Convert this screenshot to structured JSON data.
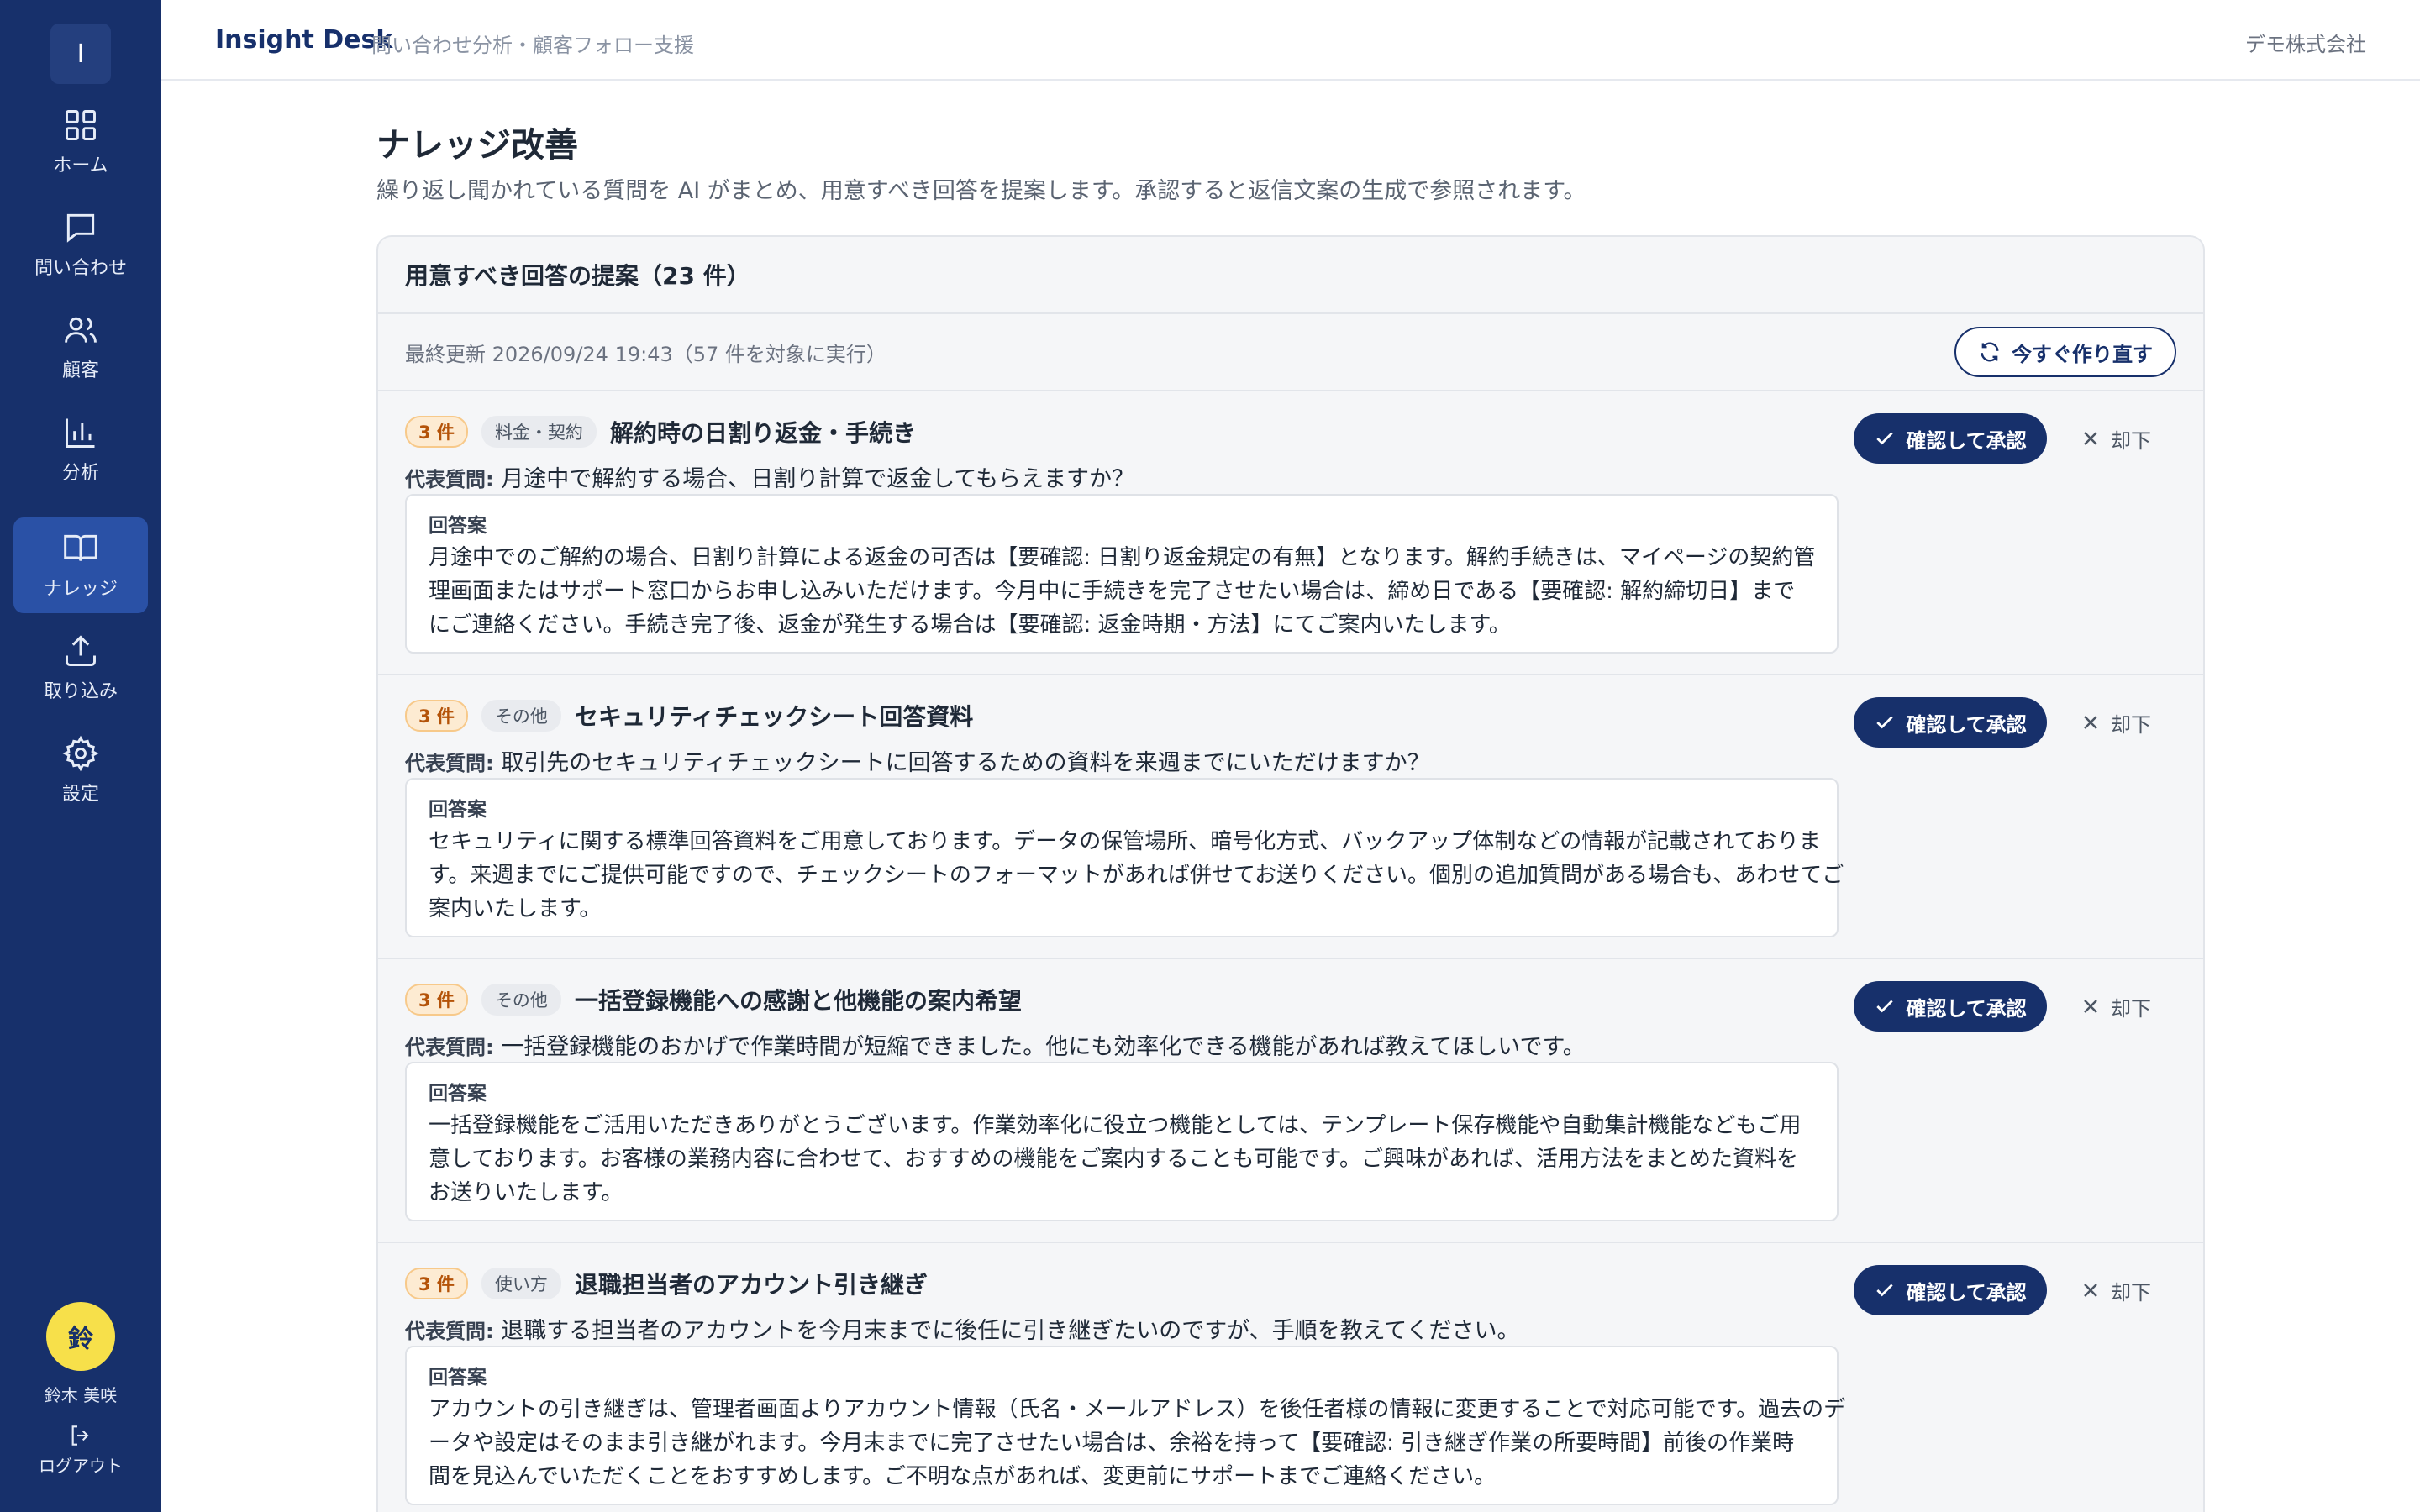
{
  "sidebar": {
    "logo": "I",
    "items": [
      {
        "label": "ホーム",
        "icon": "grid-icon"
      },
      {
        "label": "問い合わせ",
        "icon": "message-icon"
      },
      {
        "label": "顧客",
        "icon": "users-icon"
      },
      {
        "label": "分析",
        "icon": "bar-chart-icon"
      },
      {
        "label": "ナレッジ",
        "icon": "book-icon",
        "active": true
      },
      {
        "label": "取り込み",
        "icon": "upload-icon"
      },
      {
        "label": "設定",
        "icon": "gear-icon"
      }
    ],
    "user": {
      "avatar": "鈴",
      "name": "鈴木 美咲"
    },
    "logout": "ログアウト"
  },
  "header": {
    "app_name": "Insight Desk",
    "tagline": "問い合わせ分析・顧客フォロー支援",
    "company": "デモ株式会社"
  },
  "page": {
    "title": "ナレッジ改善",
    "description": "繰り返し聞かれている質問を AI がまとめ、用意すべき回答を提案します。承認すると返信文案の生成で参照されます。"
  },
  "panel": {
    "title": "用意すべき回答の提案（23 件）",
    "last_updated": "最終更新 2026/09/24 19:43（57 件を対象に実行）",
    "rebuild_label": "今すぐ作り直す"
  },
  "labels": {
    "rep_question": "代表質問:",
    "answer": "回答案",
    "approve": "確認して承認",
    "reject": "却下"
  },
  "items": [
    {
      "count": "3 件",
      "category": "料金・契約",
      "title": "解約時の日割り返金・手続き",
      "question": "月途中で解約する場合、日割り計算で返金してもらえますか？",
      "answer_lines": [
        "月途中でのご解約の場合、日割り計算による返金の可否は【要確認: 日割り返金規定の有無】となります。解約手続きは、マイページの契約管",
        "理画面またはサポート窓口からお申し込みいただけます。今月中に手続きを完了させたい場合は、締め日である【要確認: 解約締切日】まで",
        "にご連絡ください。手続き完了後、返金が発生する場合は【要確認: 返金時期・方法】にてご案内いたします。"
      ]
    },
    {
      "count": "3 件",
      "category": "その他",
      "title": "セキュリティチェックシート回答資料",
      "question": "取引先のセキュリティチェックシートに回答するための資料を来週までにいただけますか？",
      "answer_lines": [
        "セキュリティに関する標準回答資料をご用意しております。データの保管場所、暗号化方式、バックアップ体制などの情報が記載されておりま",
        "す。来週までにご提供可能ですので、チェックシートのフォーマットがあれば併せてお送りください。個別の追加質問がある場合も、あわせてご",
        "案内いたします。"
      ]
    },
    {
      "count": "3 件",
      "category": "その他",
      "title": "一括登録機能への感謝と他機能の案内希望",
      "question": "一括登録機能のおかげで作業時間が短縮できました。他にも効率化できる機能があれば教えてほしいです。",
      "answer_lines": [
        "一括登録機能をご活用いただきありがとうございます。作業効率化に役立つ機能としては、テンプレート保存機能や自動集計機能などもご用",
        "意しております。お客様の業務内容に合わせて、おすすめの機能をご案内することも可能です。ご興味があれば、活用方法をまとめた資料を",
        "お送りいたします。"
      ]
    },
    {
      "count": "3 件",
      "category": "使い方",
      "title": "退職担当者のアカウント引き継ぎ",
      "question": "退職する担当者のアカウントを今月末までに後任に引き継ぎたいのですが、手順を教えてください。",
      "answer_lines": [
        "アカウントの引き継ぎは、管理者画面よりアカウント情報（氏名・メールアドレス）を後任者様の情報に変更することで対応可能です。過去のデ",
        "ータや設定はそのまま引き継がれます。今月末までに完了させたい場合は、余裕を持って【要確認: 引き継ぎ作業の所要時間】前後の作業時",
        "間を見込んでいただくことをおすすめします。ご不明な点があれば、変更前にサポートまでご連絡ください。"
      ]
    }
  ]
}
